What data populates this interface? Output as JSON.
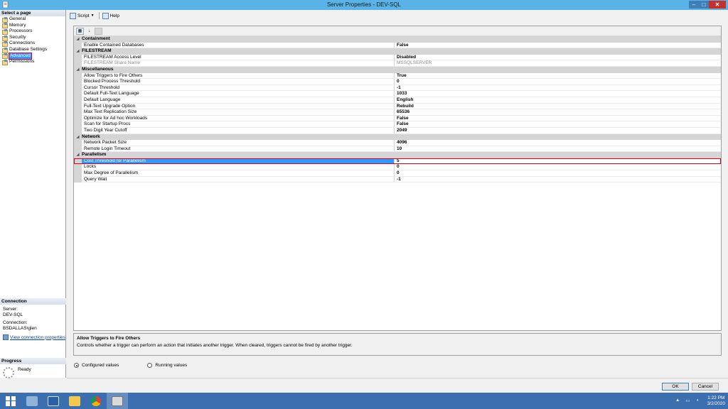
{
  "window": {
    "title": "Server Properties - DEV-SQL",
    "minimize": "–",
    "maximize": "□",
    "close": "✕"
  },
  "left_pane": {
    "select_page_heading": "Select a page",
    "pages": [
      {
        "label": "General"
      },
      {
        "label": "Memory"
      },
      {
        "label": "Processors"
      },
      {
        "label": "Security"
      },
      {
        "label": "Connections"
      },
      {
        "label": "Database Settings"
      },
      {
        "label": "Advanced",
        "selected": true
      },
      {
        "label": "Permissions"
      }
    ],
    "connection_heading": "Connection",
    "server_label": "Server:",
    "server_value": "DEV-SQL",
    "connection_label": "Connection:",
    "connection_value": "BSDALLAS\\glen",
    "view_connection_link": "View connection properties",
    "progress_heading": "Progress",
    "progress_status": "Ready"
  },
  "toolbar": {
    "script_label": "Script",
    "help_label": "Help"
  },
  "grid": {
    "categories": [
      {
        "name": "Containment",
        "properties": [
          {
            "name": "Enable Contained Databases",
            "value": "False"
          }
        ]
      },
      {
        "name": "FILESTREAM",
        "properties": [
          {
            "name": "FILESTREAM Access Level",
            "value": "Disabled"
          },
          {
            "name": "FILESTREAM Share Name",
            "value": "MSSQLSERVER",
            "disabled": true
          }
        ]
      },
      {
        "name": "Miscellaneous",
        "properties": [
          {
            "name": "Allow Triggers to Fire Others",
            "value": "True"
          },
          {
            "name": "Blocked Process Threshold",
            "value": "0"
          },
          {
            "name": "Cursor Threshold",
            "value": "-1"
          },
          {
            "name": "Default Full-Text Language",
            "value": "1033"
          },
          {
            "name": "Default Language",
            "value": "English"
          },
          {
            "name": "Full-Text Upgrade Option",
            "value": "Rebuild"
          },
          {
            "name": "Max Text Replication Size",
            "value": "65536"
          },
          {
            "name": "Optimize for Ad hoc Workloads",
            "value": "False"
          },
          {
            "name": "Scan for Startup Procs",
            "value": "False"
          },
          {
            "name": "Two Digit Year Cutoff",
            "value": "2049"
          }
        ]
      },
      {
        "name": "Network",
        "properties": [
          {
            "name": "Network Packet Size",
            "value": "4096"
          },
          {
            "name": "Remote Login Timeout",
            "value": "10"
          }
        ]
      },
      {
        "name": "Parallelism",
        "properties": [
          {
            "name": "Cost Threshold for Parallelism",
            "value": "5",
            "highlight": true
          },
          {
            "name": "Locks",
            "value": "0"
          },
          {
            "name": "Max Degree of Parallelism",
            "value": "0"
          },
          {
            "name": "Query Wait",
            "value": "-1"
          }
        ]
      }
    ]
  },
  "description": {
    "title": "Allow Triggers to Fire Others",
    "text": "Controls whether a trigger can perform an action that initiates another trigger. When cleared, triggers cannot be fired by another trigger."
  },
  "options": {
    "configured_label": "Configured values",
    "running_label": "Running values",
    "selected": "configured"
  },
  "buttons": {
    "ok_label": "OK",
    "cancel_label": "Cancel"
  },
  "taskbar": {
    "time": "1:22 PM",
    "date": "3/2/2020"
  },
  "colors": {
    "titlebar": "#5ab3e6",
    "selection": "#3399ff",
    "highlight_box": "#e0001b",
    "taskbar": "#3b6fb0"
  }
}
